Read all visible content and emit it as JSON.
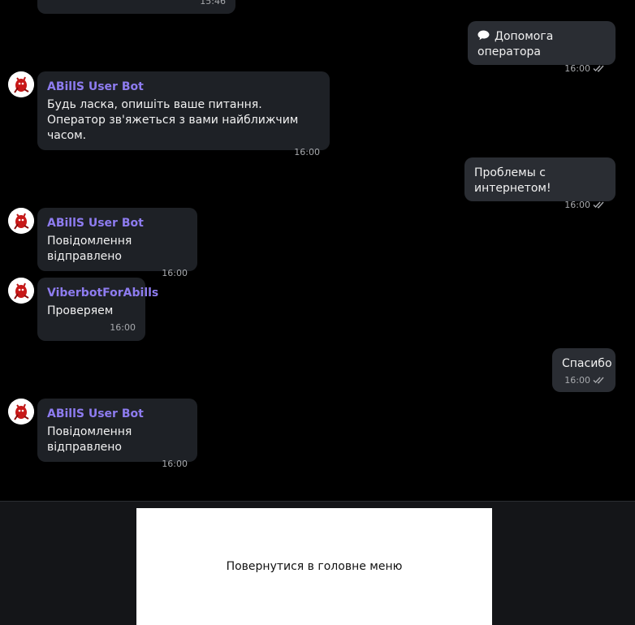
{
  "messages": [
    {
      "time": "15:46"
    },
    {
      "text": "Допомога оператора",
      "icon": "speech-bubble-icon",
      "time": "16:00"
    },
    {
      "sender": "ABillS User Bot",
      "text": "Будь ласка, опишіть ваше питання. Оператор зв'яжеться з вами найближчим часом.",
      "time": "16:00"
    },
    {
      "text": "Проблемы с интернетом!",
      "time": "16:00"
    },
    {
      "sender": "ABillS User Bot",
      "text": "Повідомлення відправлено",
      "time": "16:00"
    },
    {
      "sender": "ViberbotForAbills",
      "text": "Проверяем",
      "time": "16:00"
    },
    {
      "text": "Спасибо",
      "time": "16:00"
    },
    {
      "sender": "ABillS User Bot",
      "text": "Повідомлення відправлено",
      "time": "16:00"
    }
  ],
  "keyboard": {
    "back_button_label": "Повернутися в головне меню"
  },
  "colors": {
    "background": "#000000",
    "incoming_bubble": "#1e2126",
    "outgoing_bubble": "#2a2d33",
    "sender_name": "#8e7cf0",
    "keyboard_bar": "#141518",
    "keyboard_button": "#ffffff"
  }
}
